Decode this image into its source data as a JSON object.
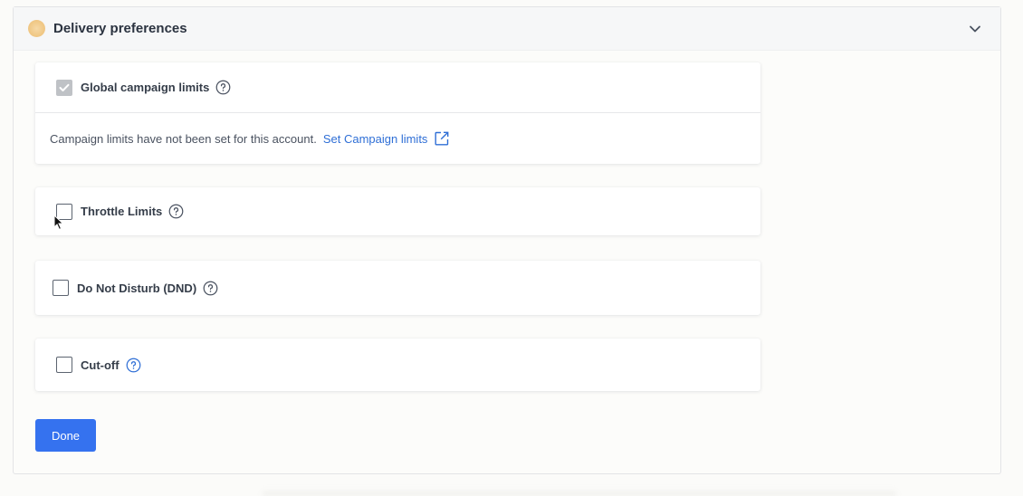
{
  "header": {
    "title": "Delivery preferences",
    "icon": "status-dot-icon",
    "collapse_icon": "chevron-down-icon"
  },
  "sections": {
    "global_limits": {
      "label": "Global campaign limits",
      "checked": true,
      "disabled": true,
      "message": "Campaign limits have not been set for this account.",
      "link_text": "Set Campaign limits",
      "link_icon": "external-link-icon"
    },
    "throttle": {
      "label": "Throttle Limits",
      "checked": false
    },
    "dnd": {
      "label": "Do Not Disturb (DND)",
      "checked": false
    },
    "cutoff": {
      "label": "Cut-off",
      "checked": false
    }
  },
  "actions": {
    "done_label": "Done"
  },
  "colors": {
    "primary": "#3572ef",
    "link": "#2f6fd6",
    "help_active": "#2f6fd6",
    "help_default": "#4a5260"
  }
}
